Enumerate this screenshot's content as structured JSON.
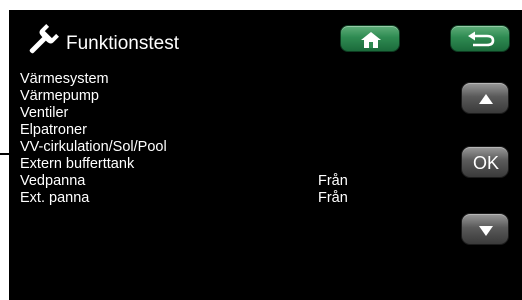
{
  "header": {
    "title": "Funktionstest",
    "title_icon": "wrench-icon",
    "home_icon": "home-icon",
    "back_icon": "back-arrow-icon"
  },
  "menu": {
    "items": [
      {
        "label": "Värmesystem",
        "value": ""
      },
      {
        "label": "Värmepump",
        "value": ""
      },
      {
        "label": "Ventiler",
        "value": ""
      },
      {
        "label": "Elpatroner",
        "value": ""
      },
      {
        "label": "VV-cirkulation/Sol/Pool",
        "value": ""
      },
      {
        "label": "Extern bufferttank",
        "value": ""
      },
      {
        "label": "Vedpanna",
        "value": "Från"
      },
      {
        "label": "Ext. panna",
        "value": "Från"
      }
    ]
  },
  "nav": {
    "ok_label": "OK",
    "up_icon": "arrow-up-icon",
    "down_icon": "arrow-down-icon"
  },
  "colors": {
    "background": "#000000",
    "text": "#ffffff",
    "green_button": "#2f8b52",
    "gray_button": "#5a5a5a"
  }
}
